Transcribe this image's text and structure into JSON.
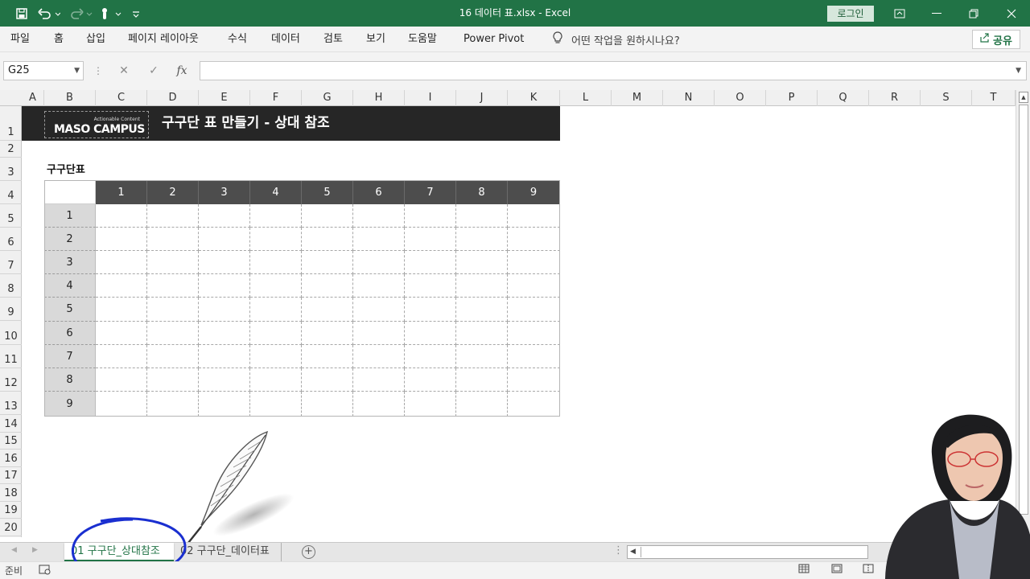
{
  "window": {
    "title": "16 데이터 표.xlsx  -  Excel",
    "login_label": "로그인",
    "accent": "#217346"
  },
  "quick_access": {
    "icons": [
      "save-icon",
      "undo-icon",
      "redo-icon",
      "touch-mode-icon",
      "customize-icon"
    ]
  },
  "ribbon": {
    "tabs": [
      "파일",
      "홈",
      "삽입",
      "페이지 레이아웃",
      "수식",
      "데이터",
      "검토",
      "보기",
      "도움말",
      "Power Pivot"
    ],
    "tell_me": "어떤 작업을 원하시나요?",
    "share": "공유"
  },
  "formula_bar": {
    "name_box": "G25",
    "cancel": "✕",
    "enter": "✓",
    "fx": "fx",
    "value": ""
  },
  "grid": {
    "columns": [
      "A",
      "B",
      "C",
      "D",
      "E",
      "F",
      "G",
      "H",
      "I",
      "J",
      "K",
      "L",
      "M",
      "N",
      "O",
      "P",
      "Q",
      "R",
      "S",
      "T"
    ],
    "rows": [
      "1",
      "2",
      "3",
      "4",
      "5",
      "6",
      "7",
      "8",
      "9",
      "10",
      "11",
      "12",
      "13",
      "14",
      "15",
      "16",
      "17",
      "18",
      "19",
      "20"
    ]
  },
  "banner": {
    "logo_small": "Actionable Content",
    "logo_big": "MASO CAMPUS",
    "title": "구구단 표 만들기 - 상대 참조",
    "bg": "#262626"
  },
  "multiplication_table": {
    "label": "구구단표",
    "column_headers": [
      "1",
      "2",
      "3",
      "4",
      "5",
      "6",
      "7",
      "8",
      "9"
    ],
    "row_headers": [
      "1",
      "2",
      "3",
      "4",
      "5",
      "6",
      "7",
      "8",
      "9"
    ]
  },
  "sheets": {
    "tabs": [
      "01 구구단_상대참조",
      "02 구구단_데이터표"
    ],
    "active": "01 구구단_상대참조",
    "add_label": "+",
    "more_label": "⋮"
  },
  "status": {
    "ready": "준비",
    "views": [
      "normal-view-icon",
      "page-layout-view-icon",
      "page-break-view-icon"
    ]
  }
}
